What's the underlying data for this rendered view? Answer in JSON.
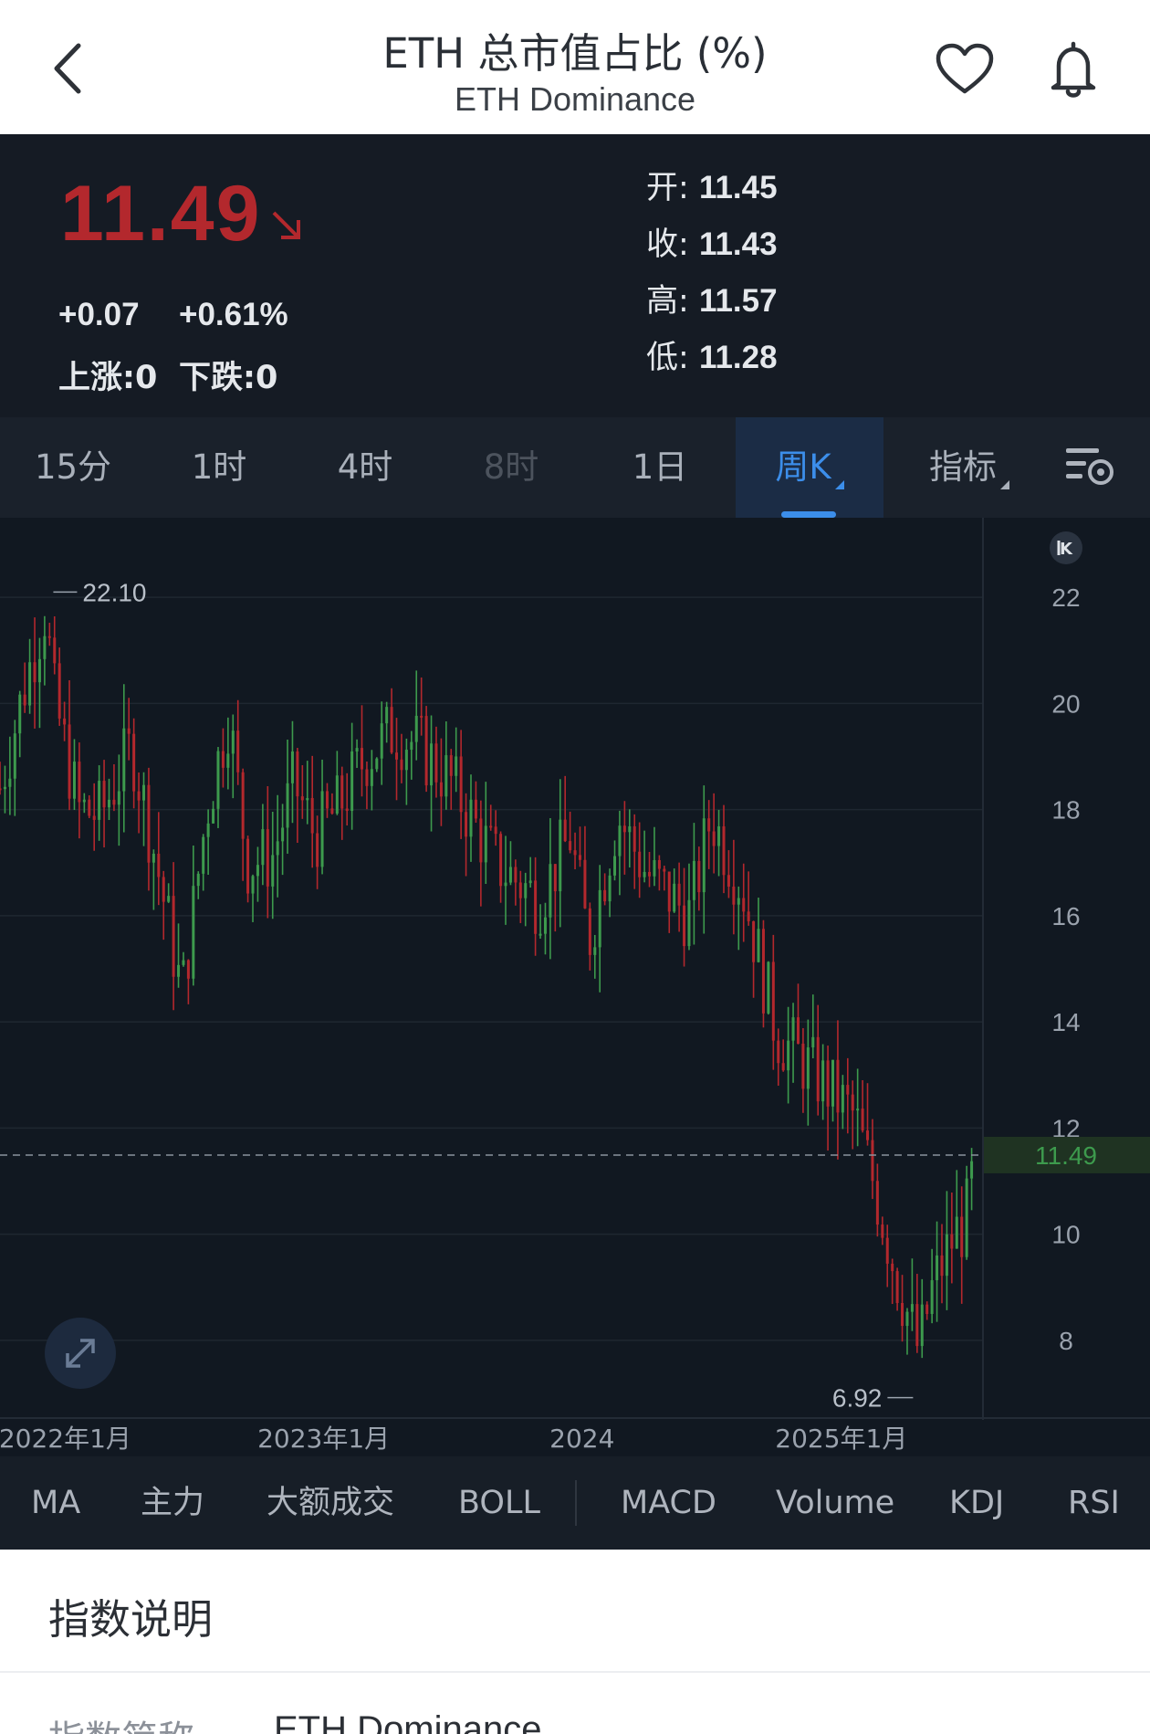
{
  "header": {
    "title": "ETH 总市值占比 (%)",
    "subtitle": "ETH Dominance",
    "icons": [
      "back-arrow-icon",
      "heart-icon",
      "bell-icon"
    ]
  },
  "quote": {
    "price": "11.49",
    "direction": "down",
    "change": "+0.07",
    "change_pct": "+0.61%",
    "up_label": "上涨:0",
    "down_label": "下跌:0",
    "open_label": "开:",
    "open": "11.45",
    "close_label": "收:",
    "close": "11.43",
    "high_label": "高:",
    "high": "11.57",
    "low_label": "低:",
    "low": "11.28",
    "colors": {
      "down": "#b3282d",
      "up": "#3d9a4d"
    }
  },
  "tabs": [
    {
      "label": "15分",
      "state": "normal"
    },
    {
      "label": "1时",
      "state": "normal"
    },
    {
      "label": "4时",
      "state": "normal"
    },
    {
      "label": "8时",
      "state": "disabled"
    },
    {
      "label": "1日",
      "state": "normal"
    },
    {
      "label": "周K",
      "state": "active"
    },
    {
      "label": "指标",
      "state": "normal"
    }
  ],
  "chart_data": {
    "type": "candlestick",
    "interval": "weekly",
    "y_ticks": [
      "22",
      "20",
      "18",
      "16",
      "14",
      "12",
      "10",
      "8"
    ],
    "ylim": [
      6.5,
      23.5
    ],
    "x_ticks": [
      "2022年1月",
      "2023年1月",
      "2024",
      "2025年1月"
    ],
    "x_tick_dates": [
      "2022-01",
      "2023-01",
      "2024-01",
      "2025-01"
    ],
    "xlim": [
      "2021-10",
      "2025-07"
    ],
    "current_value": "11.49",
    "max_label": "22.10",
    "min_label": "6.92",
    "path": [
      {
        "date": "2021-10-01",
        "close": 18.4
      },
      {
        "date": "2021-11-08",
        "close": 20.5
      },
      {
        "date": "2021-12-05",
        "close": 21.8
      },
      {
        "date": "2021-12-15",
        "close": 20.2
      },
      {
        "date": "2022-01-20",
        "close": 18.0
      },
      {
        "date": "2022-02-20",
        "close": 17.9
      },
      {
        "date": "2022-04-05",
        "close": 19.2
      },
      {
        "date": "2022-05-10",
        "close": 17.0
      },
      {
        "date": "2022-06-15",
        "close": 14.5
      },
      {
        "date": "2022-07-20",
        "close": 18.0
      },
      {
        "date": "2022-08-20",
        "close": 19.8
      },
      {
        "date": "2022-09-15",
        "close": 17.0
      },
      {
        "date": "2022-10-20",
        "close": 17.1
      },
      {
        "date": "2022-11-20",
        "close": 18.5
      },
      {
        "date": "2022-12-20",
        "close": 17.5
      },
      {
        "date": "2023-01-20",
        "close": 18.0
      },
      {
        "date": "2023-03-01",
        "close": 19.0
      },
      {
        "date": "2023-04-10",
        "close": 19.5
      },
      {
        "date": "2023-05-15",
        "close": 19.2
      },
      {
        "date": "2023-07-01",
        "close": 18.5
      },
      {
        "date": "2023-09-01",
        "close": 17.0
      },
      {
        "date": "2023-11-01",
        "close": 16.3
      },
      {
        "date": "2023-12-15",
        "close": 17.5
      },
      {
        "date": "2024-01-10",
        "close": 15.5
      },
      {
        "date": "2024-02-20",
        "close": 17.9
      },
      {
        "date": "2024-04-01",
        "close": 16.8
      },
      {
        "date": "2024-06-01",
        "close": 16.0
      },
      {
        "date": "2024-07-01",
        "close": 17.9
      },
      {
        "date": "2024-08-15",
        "close": 16.5
      },
      {
        "date": "2024-10-01",
        "close": 13.8
      },
      {
        "date": "2024-12-10",
        "close": 12.8
      },
      {
        "date": "2025-01-20",
        "close": 12.2
      },
      {
        "date": "2025-02-15",
        "close": 11.0
      },
      {
        "date": "2025-03-20",
        "close": 9.2
      },
      {
        "date": "2025-04-20",
        "close": 7.8
      },
      {
        "date": "2025-05-10",
        "close": 9.0
      },
      {
        "date": "2025-06-10",
        "close": 10.0
      },
      {
        "date": "2025-06-25",
        "close": 10.2
      },
      {
        "date": "2025-07-10",
        "close": 11.49
      }
    ]
  },
  "indicators": [
    "MA",
    "主力",
    "大额成交",
    "BOLL",
    "MACD",
    "Volume",
    "KDJ",
    "RSI"
  ],
  "description": {
    "title": "指数说明",
    "label": "指数简称",
    "value": "ETH Dominance"
  }
}
